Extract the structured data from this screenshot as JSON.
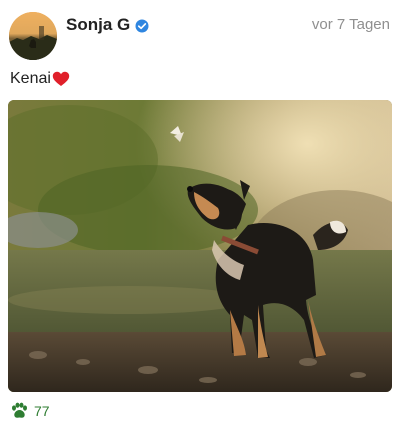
{
  "post": {
    "author": "Sonja G",
    "verified": true,
    "timestamp": "vor 7 Tagen",
    "caption": "Kenai",
    "caption_emoji": "heart-icon",
    "likes": "77",
    "like_icon": "paw-icon",
    "accent_color": "#2e7d32",
    "verified_color": "#2f86e0"
  }
}
